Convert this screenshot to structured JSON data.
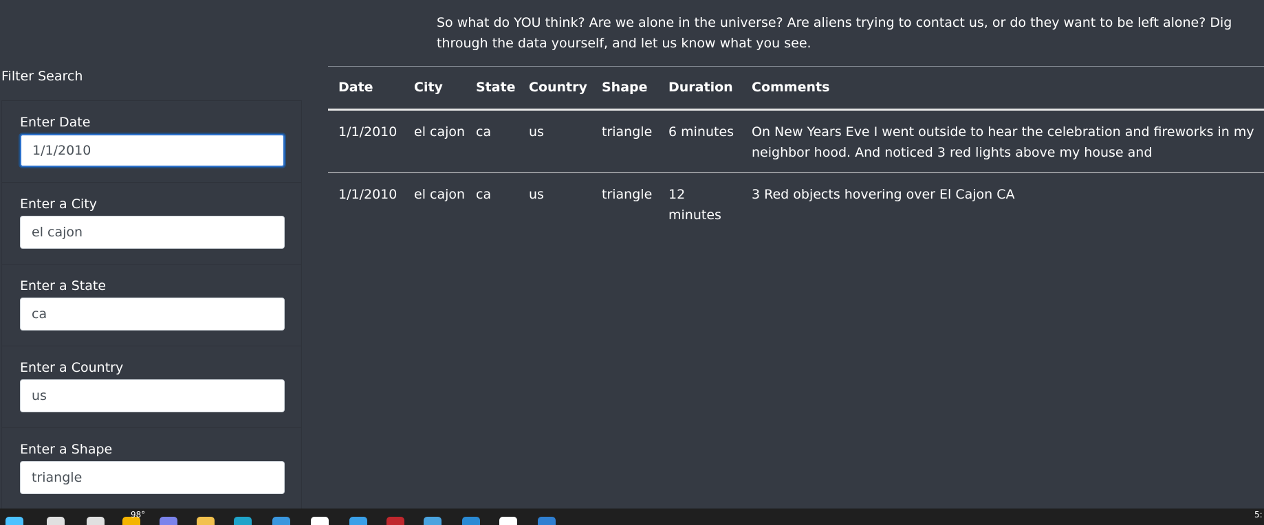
{
  "intro": {
    "text": "So what do YOU think? Are we alone in the universe? Are aliens trying to contact us, or do they want to be left alone? Dig through the data yourself, and let us know what you see."
  },
  "sidebar": {
    "title": "Filter Search",
    "filters": [
      {
        "label": "Enter Date",
        "value": "1/1/2010"
      },
      {
        "label": "Enter a City",
        "value": "el cajon"
      },
      {
        "label": "Enter a State",
        "value": "ca"
      },
      {
        "label": "Enter a Country",
        "value": "us"
      },
      {
        "label": "Enter a Shape",
        "value": "triangle"
      }
    ]
  },
  "table": {
    "headers": [
      "Date",
      "City",
      "State",
      "Country",
      "Shape",
      "Duration",
      "Comments"
    ],
    "rows": [
      [
        "1/1/2010",
        "el cajon",
        "ca",
        "us",
        "triangle",
        "6 minutes",
        "On New Years Eve I went outside to hear the celebration and fireworks in my neighbor hood. And noticed 3 red lights above my house and"
      ],
      [
        "1/1/2010",
        "el cajon",
        "ca",
        "us",
        "triangle",
        "12 minutes",
        "3 Red objects hovering over El Cajon CA"
      ]
    ]
  },
  "taskbar": {
    "weather": "98°",
    "clock": "5:",
    "icons": [
      {
        "name": "start-icon",
        "color": "#4cc2ff"
      },
      {
        "name": "search-icon",
        "color": "#e0e0e0"
      },
      {
        "name": "task-view-icon",
        "color": "#e0e0e0"
      },
      {
        "name": "weather-icon",
        "color": "#f4b400"
      },
      {
        "name": "chat-icon",
        "color": "#7b83eb"
      },
      {
        "name": "file-explorer-icon",
        "color": "#f2c14e"
      },
      {
        "name": "edge-icon",
        "color": "#1fa3c9"
      },
      {
        "name": "store-icon",
        "color": "#3a96dd"
      },
      {
        "name": "chrome-icon",
        "color": "#ffffff"
      },
      {
        "name": "browser-icon",
        "color": "#3aa0e8"
      },
      {
        "name": "mail-icon",
        "color": "#c0272d"
      },
      {
        "name": "notepad-icon",
        "color": "#4aa3df"
      },
      {
        "name": "vscode-icon",
        "color": "#2a8ad4"
      },
      {
        "name": "github-icon",
        "color": "#ffffff"
      },
      {
        "name": "outlook-icon",
        "color": "#2f7fd1"
      }
    ]
  }
}
